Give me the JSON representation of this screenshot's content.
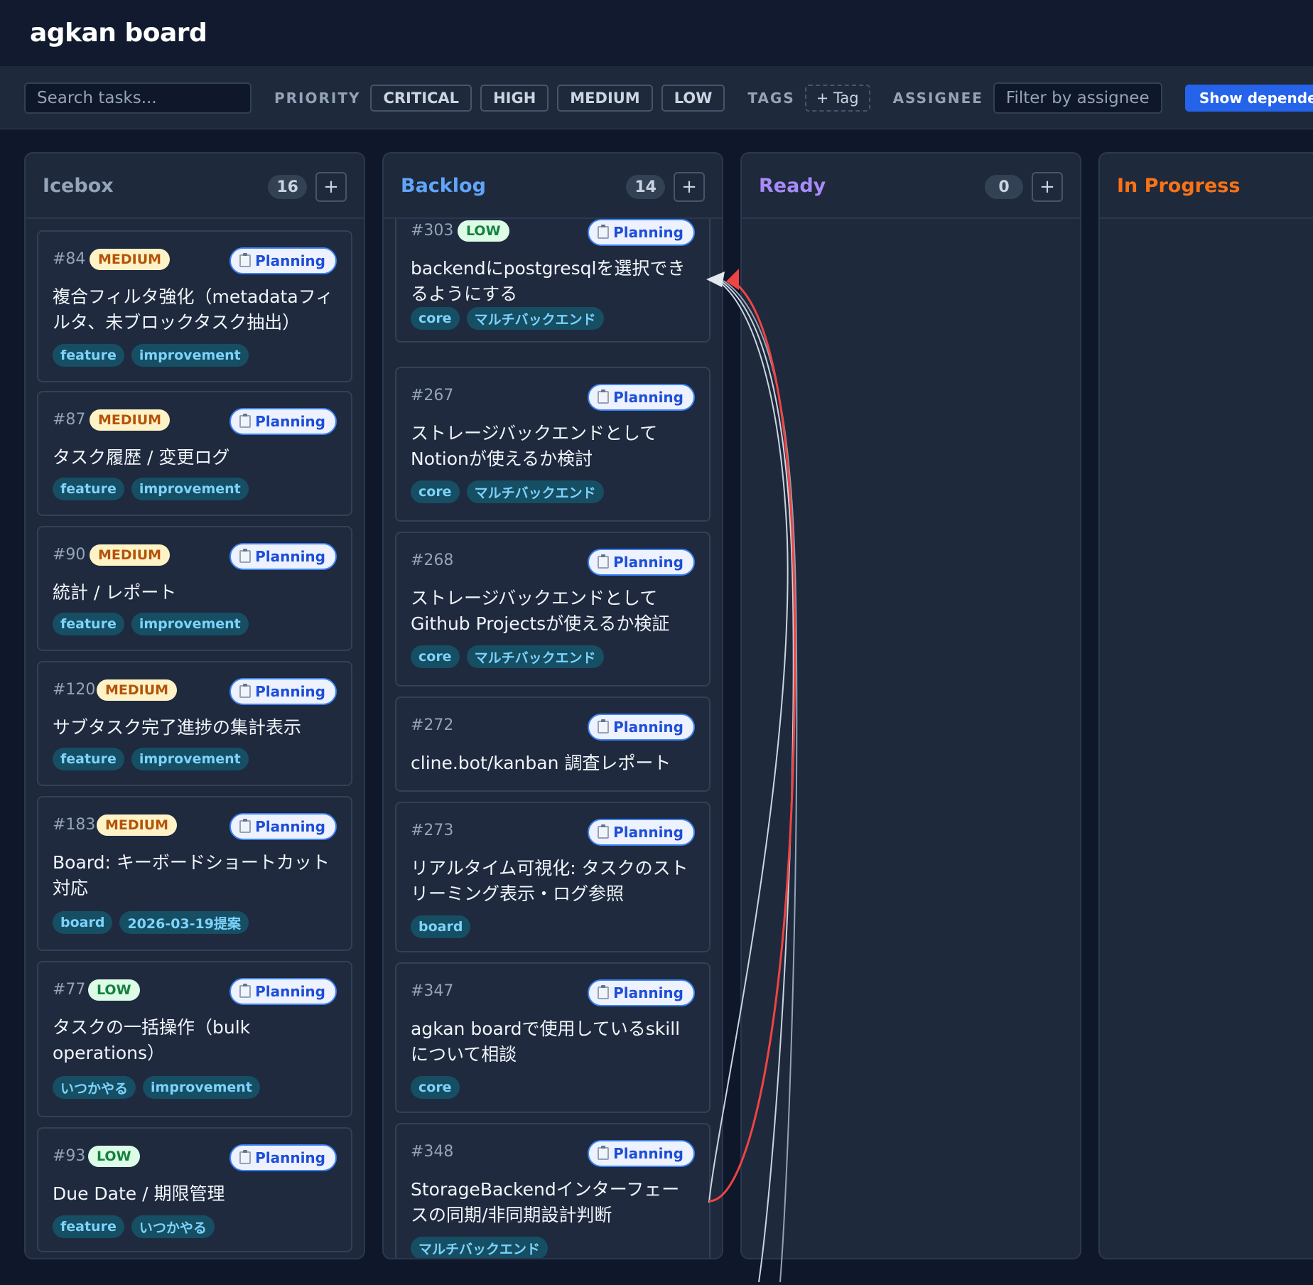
{
  "app": {
    "title": "agkan board"
  },
  "toolbar": {
    "search_placeholder": "Search tasks...",
    "priority_label": "PRIORITY",
    "priorities": [
      "CRITICAL",
      "HIGH",
      "MEDIUM",
      "LOW"
    ],
    "tags_label": "TAGS",
    "add_tag": "+ Tag",
    "assignee_label": "ASSIGNEE",
    "assignee_placeholder": "Filter by assignee",
    "dependencies_button": "Show dependencies"
  },
  "status_icon": "clipboard-icon",
  "colors": {
    "icebox": "#94a3b8",
    "backlog": "#60a5fa",
    "ready": "#a78bfa",
    "in_progress": "#f97316",
    "dependency_critical": "#ef4444",
    "dependency_normal": "#cbd5e1"
  },
  "columns": {
    "icebox": {
      "title": "Icebox",
      "count": "16",
      "add": "+",
      "cards": [
        {
          "id": "#84",
          "priority": "MEDIUM",
          "status": "Planning",
          "title": "複合フィルタ強化（metadataフィルタ、未ブロックタスク抽出）",
          "tags": [
            "feature",
            "improvement"
          ]
        },
        {
          "id": "#87",
          "priority": "MEDIUM",
          "status": "Planning",
          "title": "タスク履歴 / 変更ログ",
          "tags": [
            "feature",
            "improvement"
          ]
        },
        {
          "id": "#90",
          "priority": "MEDIUM",
          "status": "Planning",
          "title": "統計 / レポート",
          "tags": [
            "feature",
            "improvement"
          ]
        },
        {
          "id": "#120",
          "priority": "MEDIUM",
          "status": "Planning",
          "title": "サブタスク完了進捗の集計表示",
          "tags": [
            "feature",
            "improvement"
          ]
        },
        {
          "id": "#183",
          "priority": "MEDIUM",
          "status": "Planning",
          "title": "Board: キーボードショートカット対応",
          "tags": [
            "board",
            "2026-03-19提案"
          ]
        },
        {
          "id": "#77",
          "priority": "LOW",
          "status": "Planning",
          "title": "タスクの一括操作（bulk operations）",
          "tags": [
            "いつかやる",
            "improvement"
          ]
        },
        {
          "id": "#93",
          "priority": "LOW",
          "status": "Planning",
          "title": "Due Date / 期限管理",
          "tags": [
            "feature",
            "いつかやる"
          ]
        }
      ]
    },
    "backlog": {
      "title": "Backlog",
      "count": "14",
      "add": "+",
      "cards": [
        {
          "id": "#303",
          "priority": "LOW",
          "status": "Planning",
          "title": "backendにpostgresqlを選択できるようにする",
          "tags": [
            "core",
            "マルチバックエンド"
          ]
        },
        {
          "id": "#267",
          "status": "Planning",
          "title": "ストレージバックエンドとしてNotionが使えるか検討",
          "tags": [
            "core",
            "マルチバックエンド"
          ]
        },
        {
          "id": "#268",
          "status": "Planning",
          "title": "ストレージバックエンドとしてGithub Projectsが使えるか検証",
          "tags": [
            "core",
            "マルチバックエンド"
          ]
        },
        {
          "id": "#272",
          "status": "Planning",
          "title": "cline.bot/kanban 調査レポート",
          "tags": []
        },
        {
          "id": "#273",
          "status": "Planning",
          "title": "リアルタイム可視化: タスクのストリーミング表示・ログ参照",
          "tags": [
            "board"
          ]
        },
        {
          "id": "#347",
          "status": "Planning",
          "title": "agkan boardで使用しているskillについて相談",
          "tags": [
            "core"
          ]
        },
        {
          "id": "#348",
          "status": "Planning",
          "title": "StorageBackendインターフェースの同期/非同期設計判断",
          "tags": [
            "マルチバックエンド"
          ]
        }
      ]
    },
    "ready": {
      "title": "Ready",
      "count": "0",
      "add": "+"
    },
    "in_progress": {
      "title": "In Progress"
    }
  }
}
